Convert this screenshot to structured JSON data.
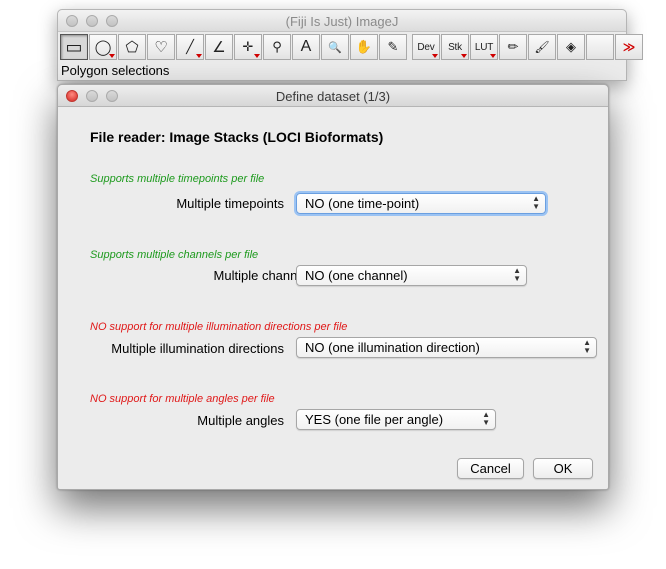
{
  "imagej": {
    "title": "(Fiji Is Just) ImageJ",
    "status": "Polygon selections",
    "tools": [
      {
        "icon": "rectangle-selection-icon",
        "glyph": "▭",
        "selected": true
      },
      {
        "icon": "oval-selection-icon",
        "glyph": "◯"
      },
      {
        "icon": "polygon-selection-icon",
        "glyph": "⬠"
      },
      {
        "icon": "freehand-selection-icon",
        "glyph": "♡"
      },
      {
        "icon": "line-selection-icon",
        "glyph": "╱"
      },
      {
        "icon": "angle-tool-icon",
        "glyph": "∠"
      },
      {
        "icon": "point-tool-icon",
        "glyph": "✛"
      },
      {
        "icon": "wand-tool-icon",
        "glyph": "⚲"
      },
      {
        "icon": "text-tool-icon",
        "glyph": "A"
      },
      {
        "icon": "magnifying-glass-icon",
        "glyph": "🔍"
      },
      {
        "icon": "hand-tool-icon",
        "glyph": "✋"
      },
      {
        "icon": "color-picker-icon",
        "glyph": "✎"
      },
      {
        "icon": "dev-menu-icon",
        "glyph": "Dev"
      },
      {
        "icon": "stk-menu-icon",
        "glyph": "Stk"
      },
      {
        "icon": "lut-menu-icon",
        "glyph": "LUT"
      },
      {
        "icon": "pencil-tool-icon",
        "glyph": "✏"
      },
      {
        "icon": "brush-tool-icon",
        "glyph": "🖌"
      },
      {
        "icon": "flood-fill-icon",
        "glyph": "◈"
      },
      {
        "icon": "more-tools-icon",
        "glyph": "≫"
      }
    ]
  },
  "dialog": {
    "title": "Define dataset (1/3)",
    "heading": "File reader: Image Stacks (LOCI Bioformats)",
    "rows": [
      {
        "note": "Supports multiple timepoints per file",
        "label": "Multiple timepoints",
        "value": "NO (one time-point)"
      },
      {
        "note": "Supports multiple channels per file",
        "label": "Multiple channels",
        "value": "NO (one channel)"
      },
      {
        "note": "NO support for multiple illumination directions per file",
        "label": "Multiple illumination directions",
        "value": "NO (one illumination direction)"
      },
      {
        "note": "NO support for multiple angles per file",
        "label": "Multiple angles",
        "value": "YES (one file per angle)"
      }
    ],
    "cancel_label": "Cancel",
    "ok_label": "OK"
  },
  "colors": {
    "supported_note": "#1d9a1d",
    "unsupported_note": "#e01818",
    "focus_ring": "#9bc3f3"
  }
}
